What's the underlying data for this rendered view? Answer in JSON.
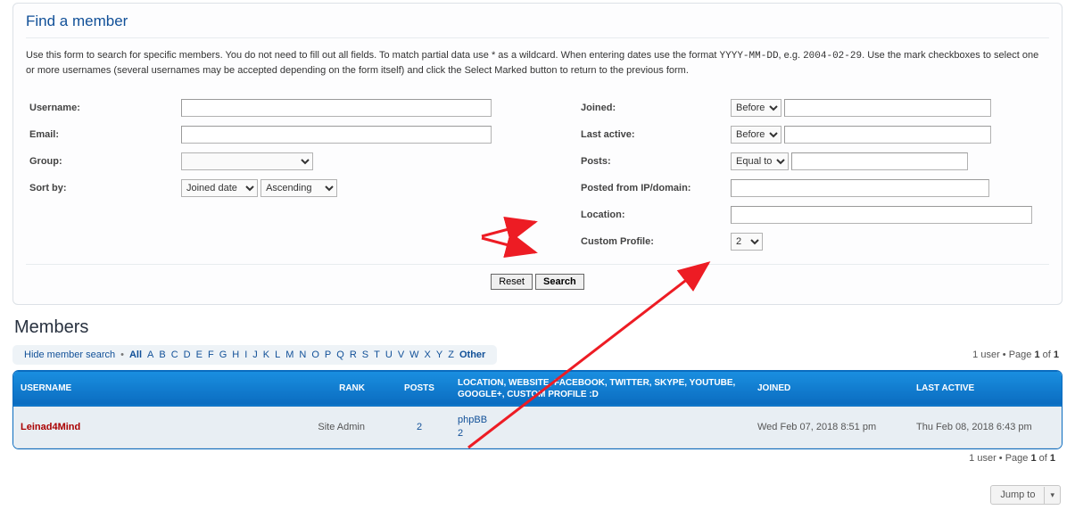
{
  "find": {
    "title": "Find a member",
    "intro_before": "Use this form to search for specific members. You do not need to fill out all fields. To match partial data use * as a wildcard. When entering dates use the format ",
    "intro_code1": "YYYY-MM-DD",
    "intro_mid": ", e.g. ",
    "intro_code2": "2004-02-29",
    "intro_after": ". Use the mark checkboxes to select one or more usernames (several usernames may be accepted depending on the form itself) and click the Select Marked button to return to the previous form.",
    "labels": {
      "username": "Username:",
      "email": "Email:",
      "group": "Group:",
      "sortby": "Sort by:",
      "joined": "Joined:",
      "lastactive": "Last active:",
      "posts": "Posts:",
      "ip": "Posted from IP/domain:",
      "location": "Location:",
      "customprofile": "Custom Profile:"
    },
    "selects": {
      "group_placeholder": "",
      "sort_field": "Joined date",
      "sort_dir": "Ascending",
      "joined_when": "Before",
      "lastactive_when": "Before",
      "posts_op": "Equal to",
      "customprofile": "2"
    },
    "buttons": {
      "reset": "Reset",
      "search": "Search"
    }
  },
  "members": {
    "heading": "Members",
    "hide_link": "Hide member search",
    "all_label": "All",
    "letters": [
      "A",
      "B",
      "C",
      "D",
      "E",
      "F",
      "G",
      "H",
      "I",
      "J",
      "K",
      "L",
      "M",
      "N",
      "O",
      "P",
      "Q",
      "R",
      "S",
      "T",
      "U",
      "V",
      "W",
      "X",
      "Y",
      "Z"
    ],
    "other_label": "Other",
    "pager_prefix": "1 user • Page ",
    "pager_page": "1",
    "pager_mid": " of ",
    "pager_total": "1",
    "cols": {
      "username": "USERNAME",
      "rank": "RANK",
      "posts": "POSTS",
      "info": "LOCATION, WEBSITE, FACEBOOK, TWITTER, SKYPE, YOUTUBE, GOOGLE+, CUSTOM PROFILE :D",
      "joined": "JOINED",
      "lastactive": "LAST ACTIVE"
    },
    "rows": [
      {
        "username": "Leinad4Mind",
        "rank": "Site Admin",
        "posts": "2",
        "info_line1": "phpBB",
        "info_line2": "2",
        "joined": "Wed Feb 07, 2018 8:51 pm",
        "lastactive": "Thu Feb 08, 2018 6:43 pm"
      }
    ],
    "jump_label": "Jump to"
  }
}
